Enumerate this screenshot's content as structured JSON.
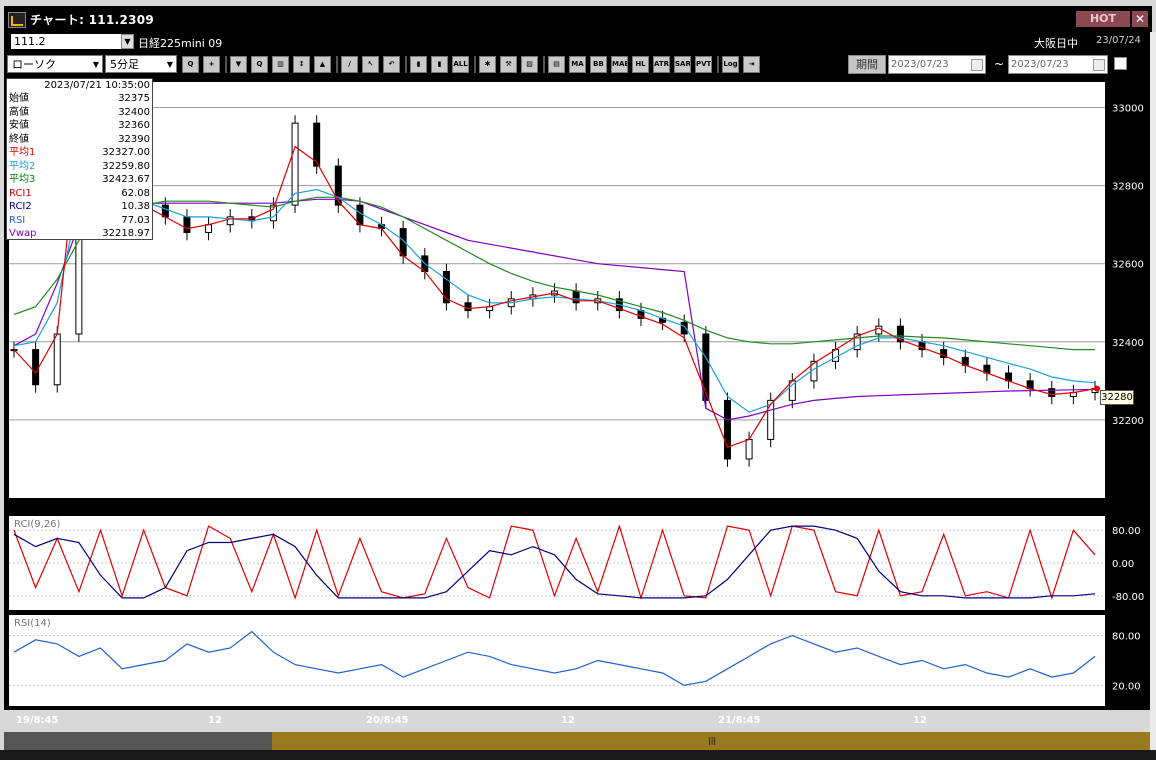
{
  "window": {
    "title": "チャート: 111.2309",
    "hot_label": "HOT",
    "close_label": "✕"
  },
  "header": {
    "symbol_value": "111.2",
    "instrument_name": "日経225mini 09",
    "market_status": "大阪日中",
    "current_date": "23/07/24"
  },
  "toolbar": {
    "chart_type": "ローソク",
    "timeframe": "5分足",
    "buttons": [
      {
        "name": "zoom-icon",
        "text": "Q"
      },
      {
        "name": "crosshair-icon",
        "text": "+"
      },
      {
        "name": "tool-3-icon",
        "text": "▼"
      },
      {
        "name": "tool-4-icon",
        "text": "Q"
      },
      {
        "name": "tool-5-icon",
        "text": "▥"
      },
      {
        "name": "tool-6-icon",
        "text": "↕"
      },
      {
        "name": "tool-7-icon",
        "text": "▲"
      },
      {
        "name": "pencil-icon",
        "text": "/"
      },
      {
        "name": "pointer-icon",
        "text": "↖"
      },
      {
        "name": "undo-icon",
        "text": "↶"
      },
      {
        "name": "bar-style-1-icon",
        "text": "▮"
      },
      {
        "name": "bar-style-2-icon",
        "text": "▮"
      },
      {
        "name": "all-button",
        "text": "ALL"
      },
      {
        "name": "settings-icon",
        "text": "✱"
      },
      {
        "name": "wrench-icon",
        "text": "⚒"
      },
      {
        "name": "color-icon",
        "text": "▨"
      },
      {
        "name": "indicator-icon",
        "text": "▤"
      },
      {
        "name": "ma-button",
        "text": "MA"
      },
      {
        "name": "bb-button",
        "text": "BB"
      },
      {
        "name": "mae-button",
        "text": "MAE"
      },
      {
        "name": "hl-button",
        "text": "HL"
      },
      {
        "name": "atr-button",
        "text": "ATR"
      },
      {
        "name": "sar-button",
        "text": "SAR"
      },
      {
        "name": "pvt-button",
        "text": "PVT"
      },
      {
        "name": "log-button",
        "text": "Log"
      },
      {
        "name": "export-icon",
        "text": "⇥"
      }
    ],
    "period_label": "期間",
    "date_from": "2023/07/23",
    "date_to": "2023/07/23",
    "range_separator": "~"
  },
  "info_panel": {
    "datetime": "2023/07/21 10:35:00",
    "rows": [
      {
        "label": "始値",
        "value": "32375",
        "color": "#000000"
      },
      {
        "label": "高値",
        "value": "32400",
        "color": "#000000"
      },
      {
        "label": "安値",
        "value": "32360",
        "color": "#000000"
      },
      {
        "label": "終値",
        "value": "32390",
        "color": "#000000"
      },
      {
        "label": "平均1",
        "value": "32327.00",
        "color": "#e00000"
      },
      {
        "label": "平均2",
        "value": "32259.80",
        "color": "#1aa0e0"
      },
      {
        "label": "平均3",
        "value": "32423.67",
        "color": "#008000"
      },
      {
        "label": "RCI1",
        "value": "62.08",
        "color": "#e00000"
      },
      {
        "label": "RCI2",
        "value": "10.38",
        "color": "#000080"
      },
      {
        "label": "RSI",
        "value": "77.03",
        "color": "#2060d0"
      },
      {
        "label": "Vwap",
        "value": "32218.97",
        "color": "#8000c0"
      }
    ]
  },
  "price_axis": [
    "33000",
    "32800",
    "32600",
    "32400",
    "32200"
  ],
  "rci_axis": [
    "80.00",
    "0.00",
    "-80.00"
  ],
  "rsi_axis": [
    "80.00",
    "20.00"
  ],
  "current_price": "32280",
  "rci_title": "RCI(9,26)",
  "rsi_title": "RSI(14)",
  "x_labels": [
    "19/8:45",
    "12",
    "20/8:45",
    "12",
    "21/8:45",
    "12"
  ],
  "colors": {
    "ma1": "#e00000",
    "ma2": "#1aa0e0",
    "ma3": "#228b22",
    "vwap": "#8000c0",
    "rci1": "#e00000",
    "rci2": "#000080",
    "rsi": "#2060d0"
  },
  "chart_data": {
    "type": "line",
    "title": "",
    "price_ylim": [
      32000,
      33050
    ],
    "close": [
      32380,
      32290,
      32420,
      32980,
      32900,
      32800,
      32750,
      32720,
      32680,
      32700,
      32720,
      32710,
      32750,
      32960,
      32850,
      32750,
      32700,
      32690,
      32620,
      32580,
      32500,
      32480,
      32490,
      32510,
      32520,
      32530,
      32500,
      32510,
      32480,
      32460,
      32450,
      32420,
      32250,
      32100,
      32150,
      32250,
      32300,
      32350,
      32380,
      32420,
      32440,
      32400,
      32380,
      32360,
      32340,
      32320,
      32300,
      32280,
      32260,
      32270,
      32280
    ],
    "ma1": [
      32380,
      32320,
      32420,
      32950,
      32880,
      32800,
      32750,
      32720,
      32690,
      32700,
      32715,
      32715,
      32740,
      32900,
      32860,
      32760,
      32700,
      32690,
      32620,
      32580,
      32510,
      32485,
      32490,
      32505,
      32515,
      32525,
      32505,
      32505,
      32485,
      32465,
      32445,
      32410,
      32270,
      32130,
      32150,
      32240,
      32300,
      32345,
      32380,
      32415,
      32435,
      32405,
      32385,
      32365,
      32340,
      32320,
      32300,
      32280,
      32265,
      32270,
      32280
    ],
    "ma2": [
      32390,
      32400,
      32500,
      32770,
      32790,
      32780,
      32760,
      32740,
      32720,
      32720,
      32715,
      32710,
      32720,
      32780,
      32790,
      32770,
      32730,
      32700,
      32660,
      32600,
      32560,
      32520,
      32500,
      32500,
      32510,
      32515,
      32510,
      32505,
      32495,
      32480,
      32460,
      32440,
      32360,
      32260,
      32220,
      32240,
      32290,
      32330,
      32360,
      32390,
      32410,
      32410,
      32400,
      32390,
      32375,
      32360,
      32345,
      32330,
      32310,
      32300,
      32295
    ],
    "ma3": [
      32470,
      32490,
      32560,
      32660,
      32700,
      32730,
      32750,
      32760,
      32760,
      32760,
      32755,
      32750,
      32745,
      32760,
      32770,
      32770,
      32760,
      32745,
      32720,
      32690,
      32660,
      32630,
      32600,
      32575,
      32555,
      32540,
      32530,
      32520,
      32505,
      32490,
      32475,
      32455,
      32430,
      32410,
      32400,
      32395,
      32395,
      32400,
      32405,
      32410,
      32415,
      32415,
      32412,
      32410,
      32405,
      32400,
      32395,
      32390,
      32385,
      32380,
      32380
    ],
    "vwap": [
      32390,
      32420,
      32550,
      32700,
      32740,
      32750,
      32755,
      32755,
      32755,
      32755,
      32755,
      32755,
      32755,
      32760,
      32765,
      32765,
      32760,
      32740,
      32720,
      32700,
      32680,
      32660,
      32650,
      32640,
      32630,
      32620,
      32610,
      32600,
      32595,
      32590,
      32585,
      32580,
      32230,
      32200,
      32210,
      32225,
      32240,
      32250,
      32255,
      32260,
      32262,
      32264,
      32266,
      32268,
      32270,
      32272,
      32274,
      32275,
      32276,
      32277,
      32278
    ],
    "rci1": [
      80,
      -60,
      60,
      -70,
      80,
      -80,
      80,
      -60,
      -80,
      90,
      60,
      -70,
      70,
      -85,
      80,
      -80,
      60,
      -70,
      -85,
      -75,
      60,
      -60,
      -85,
      90,
      80,
      -80,
      60,
      -70,
      90,
      -85,
      80,
      -80,
      -85,
      90,
      80,
      -80,
      90,
      80,
      -70,
      -80,
      80,
      -80,
      -70,
      70,
      -80,
      -70,
      -85,
      80,
      -85,
      80,
      20
    ],
    "rci2": [
      70,
      40,
      60,
      50,
      -30,
      -85,
      -85,
      -60,
      30,
      50,
      50,
      60,
      70,
      40,
      -30,
      -85,
      -85,
      -85,
      -85,
      -85,
      -70,
      -20,
      30,
      20,
      40,
      20,
      -40,
      -75,
      -80,
      -85,
      -85,
      -85,
      -80,
      -40,
      20,
      80,
      90,
      90,
      80,
      60,
      -20,
      -70,
      -80,
      -80,
      -85,
      -85,
      -85,
      -85,
      -80,
      -80,
      -75
    ],
    "rsi": [
      60,
      75,
      70,
      55,
      65,
      40,
      45,
      50,
      70,
      60,
      65,
      85,
      60,
      45,
      40,
      35,
      40,
      45,
      30,
      40,
      50,
      60,
      55,
      45,
      40,
      35,
      40,
      50,
      45,
      40,
      35,
      20,
      25,
      40,
      55,
      70,
      80,
      70,
      60,
      65,
      55,
      45,
      50,
      40,
      45,
      35,
      30,
      40,
      30,
      35,
      55
    ]
  }
}
